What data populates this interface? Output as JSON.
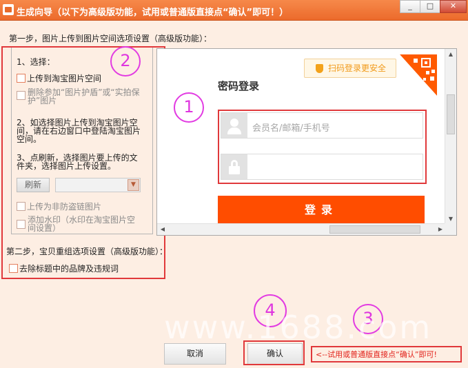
{
  "window": {
    "title": "生成向导（以下为高级版功能，试用或普通版直接点“确认”即可！）",
    "min_glyph": "_",
    "max_glyph": "□",
    "close_glyph": "✕"
  },
  "step1_label": "第一步，图片上传到图片空间选项设置（高级版功能）：",
  "left_panel": {
    "select_heading": "1、选择：",
    "upload_taobao": "上传到淘宝图片空间",
    "delete_protect": "删除参加“图片护盾”或“实拍保护”图片",
    "instruction2": "2、如选择图片上传到淘宝图片空间，请在右边窗口中登陆淘宝图片空间。",
    "instruction3": "3、点刷新，选择图片要上传的文件夹，选择图片上传设置。",
    "refresh_label": "刷新",
    "folder_value": "",
    "upload_anti_leech": "上传为非防盗链图片",
    "add_watermark": "添加水印（水印在淘宝图片空间设置）"
  },
  "step2_label": "第二步，宝贝重组选项设置（高级版功能）：",
  "remove_brand": "去除标题中的品牌及违规词",
  "login": {
    "qr_tip": "扫码登录更安全",
    "title": "密码登录",
    "username_placeholder": "会员名/邮箱/手机号",
    "password_placeholder": "",
    "login_button": "登录"
  },
  "annotations": [
    "1",
    "2",
    "3",
    "4"
  ],
  "watermark": "www.1688.com",
  "buttons": {
    "cancel": "取消",
    "confirm": "确认"
  },
  "hint": "<--试用或普通版直接点“确认”即可!",
  "colors": {
    "title_bar": "#ec6a2b",
    "login_button": "#ff4d00",
    "annotation_red": "#e0383a",
    "annotation_magenta": "#e23be2"
  }
}
